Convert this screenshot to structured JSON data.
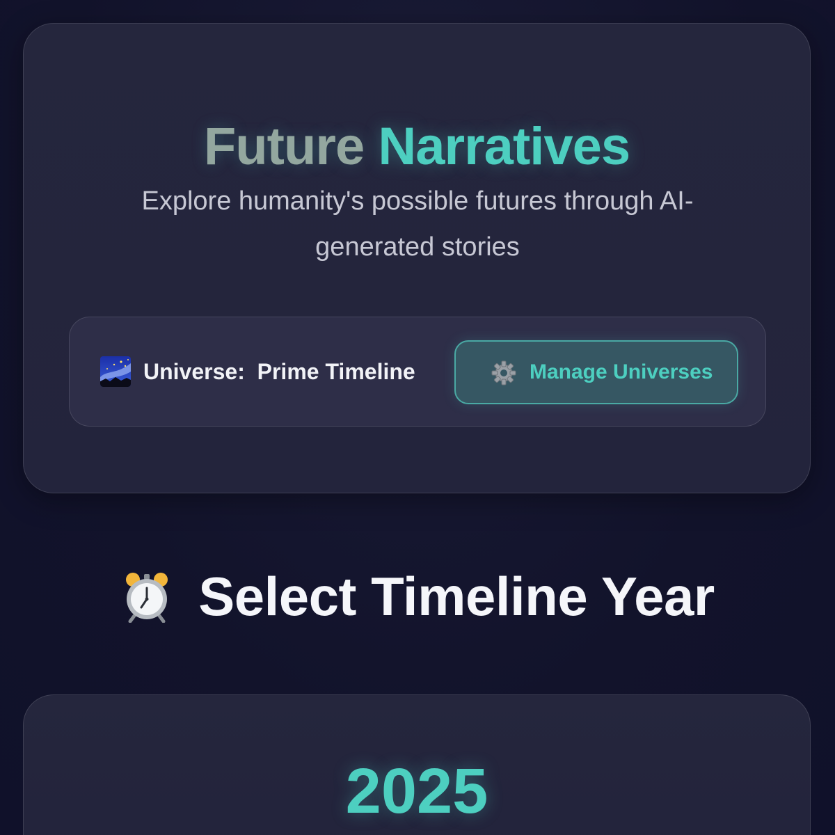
{
  "header": {
    "title_word1": "Future",
    "title_word2": "Narratives",
    "subtitle": "Explore humanity's possible futures through AI-generated stories"
  },
  "universe": {
    "icon": "milky-way-icon",
    "label": "Universe:  Prime Timeline",
    "manage_button": {
      "icon": "gear-icon",
      "label": "Manage Universes"
    }
  },
  "timeline": {
    "icon": "alarm-clock-icon",
    "heading": "Select Timeline Year",
    "year": "2025"
  },
  "colors": {
    "background": "#12132b",
    "card": "#25263d",
    "accent": "#4dcfc0",
    "title_muted": "#93a79f"
  }
}
